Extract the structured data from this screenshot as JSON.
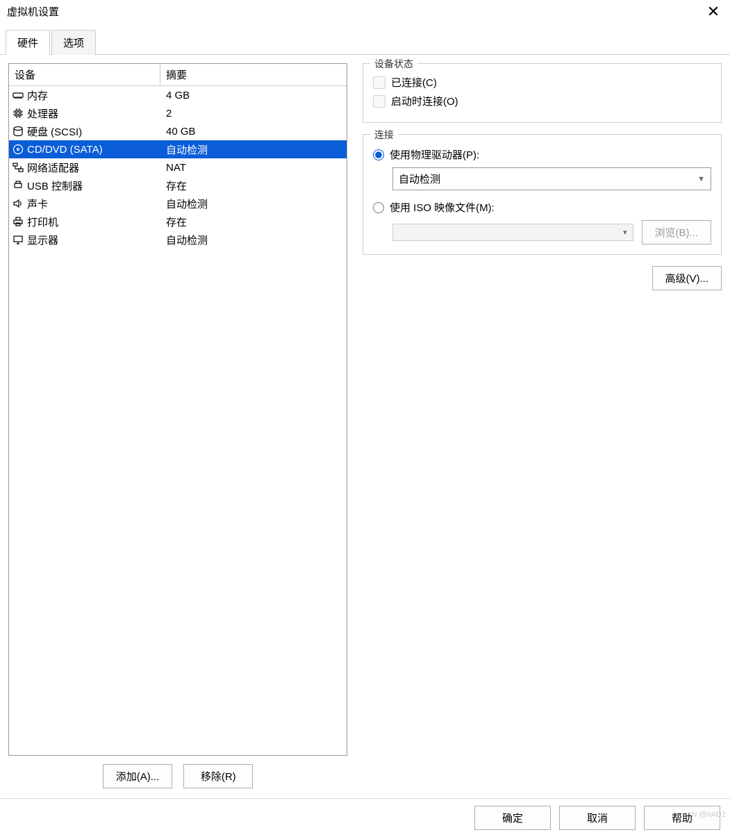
{
  "window": {
    "title": "虚拟机设置"
  },
  "tabs": {
    "hardware": "硬件",
    "options": "选项"
  },
  "table": {
    "headers": {
      "device": "设备",
      "summary": "摘要"
    },
    "rows": [
      {
        "icon": "memory-icon",
        "device": "内存",
        "summary": "4 GB",
        "selected": false
      },
      {
        "icon": "cpu-icon",
        "device": "处理器",
        "summary": "2",
        "selected": false
      },
      {
        "icon": "disk-icon",
        "device": "硬盘 (SCSI)",
        "summary": "40 GB",
        "selected": false
      },
      {
        "icon": "cd-icon",
        "device": "CD/DVD (SATA)",
        "summary": "自动检测",
        "selected": true
      },
      {
        "icon": "network-icon",
        "device": "网络适配器",
        "summary": "NAT",
        "selected": false
      },
      {
        "icon": "usb-icon",
        "device": "USB 控制器",
        "summary": "存在",
        "selected": false
      },
      {
        "icon": "sound-icon",
        "device": "声卡",
        "summary": "自动检测",
        "selected": false
      },
      {
        "icon": "printer-icon",
        "device": "打印机",
        "summary": "存在",
        "selected": false
      },
      {
        "icon": "display-icon",
        "device": "显示器",
        "summary": "自动检测",
        "selected": false
      }
    ]
  },
  "leftButtons": {
    "add": "添加(A)...",
    "remove": "移除(R)"
  },
  "deviceStatus": {
    "title": "设备状态",
    "connected": "已连接(C)",
    "connectAtPowerOn": "启动时连接(O)"
  },
  "connection": {
    "title": "连接",
    "usePhysical": "使用物理驱动器(P):",
    "physicalSelected": "自动检测",
    "useIso": "使用 ISO 映像文件(M):",
    "isoPath": "",
    "browse": "浏览(B)..."
  },
  "advanced": "高级(V)...",
  "footer": {
    "ok": "确定",
    "cancel": "取消",
    "help": "帮助"
  },
  "watermark": "N @IIAD2"
}
